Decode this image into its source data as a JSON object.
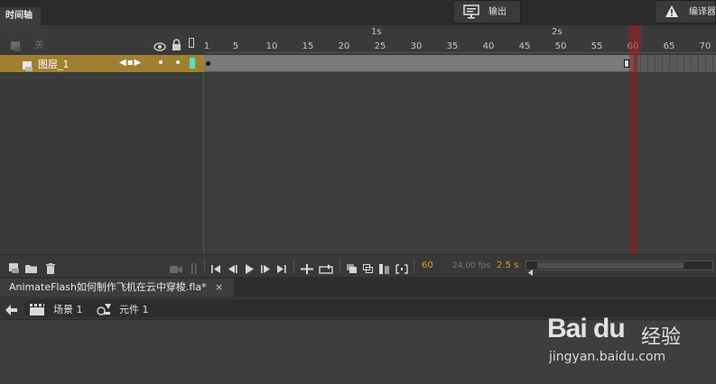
{
  "panel_tabs": {
    "timeline": "时间轴",
    "output": "输出",
    "compiler": "编译器"
  },
  "layer_header": {
    "label": "关"
  },
  "ruler": {
    "seconds": [
      {
        "label": "1s",
        "frame": 25
      },
      {
        "label": "2s",
        "frame": 50
      }
    ],
    "frame_numbers": [
      "1",
      "5",
      "10",
      "15",
      "20",
      "25",
      "30",
      "35",
      "40",
      "45",
      "50",
      "55",
      "60",
      "65",
      "70"
    ]
  },
  "layers": [
    {
      "name": "图层_1",
      "keyframe_nav": "◀▪▶"
    }
  ],
  "toolbar": {
    "current_frame": "60",
    "fps": "24.00 fps",
    "time": "2.5 s"
  },
  "document": {
    "tab_label": "AnimateFlash如何制作飞机在云中穿梭.fla*",
    "close": "×"
  },
  "breadcrumb": {
    "scene": "场景 1",
    "symbol": "元件 1"
  },
  "watermark": {
    "logo": "Bai du",
    "cn": "经验",
    "url": "jingyan.baidu.com"
  },
  "colors": {
    "layer_highlight": "#a08030",
    "layer_swatch": "#4de6c0",
    "playhead": "#a01e1e",
    "accent_orange": "#e0a020"
  }
}
